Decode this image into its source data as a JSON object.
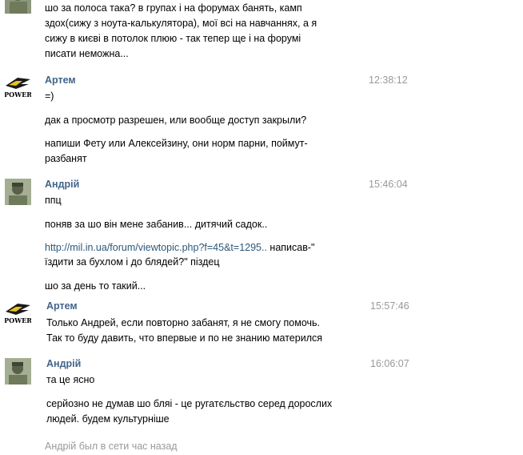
{
  "messages": [
    {
      "lines": [
        "шо за полоса така? в групах і на форумах банять, камп",
        "здох(сижу з ноута-калькулятора), мої всі на навчаннях, а я",
        "сижу в києві в потолок плюю - так тепер ще і на форумі",
        "писати неможна..."
      ]
    },
    {
      "author": "Артем",
      "time": "12:38:12",
      "avatar_text": "POWER",
      "lines": [
        "=)"
      ],
      "extra": [
        [
          "дак а просмотр разрешен, или вообще доступ закрыли?"
        ],
        [
          "напиши Фету или Алексейзину, они норм парни, поймут-",
          "разбанят"
        ]
      ]
    },
    {
      "author": "Андрій",
      "time": "15:46:04",
      "lines": [
        "ппц"
      ],
      "extra": [
        [
          "поняв за шо він мене забанив... дитячий садок.."
        ],
        [
          "http://mil.in.ua/forum/viewtopic.php?f=45&t=1295..",
          " написав-\"",
          "їздити за бухлом і до блядей?\" піздец"
        ],
        [
          "шо за день то такий..."
        ]
      ]
    },
    {
      "author": "Артем",
      "time": "15:57:46",
      "avatar_text": "POWER",
      "lines": [
        "Только Андрей, если повторно забанят, я не смогу помочь.",
        "Так то буду давить, что впервые и по не знанию матерился"
      ]
    },
    {
      "author": "Андрій",
      "time": "16:06:07",
      "lines": [
        "та це ясно"
      ],
      "extra": [
        [
          "серйозно не думав шо бляі - це ругатєльство серед дорослих",
          "людей. будем культурніше"
        ]
      ]
    }
  ],
  "status": "Андрій был в сети час назад",
  "colors": {
    "author": "#42648b",
    "time": "#999999",
    "link": "#2b587a"
  }
}
